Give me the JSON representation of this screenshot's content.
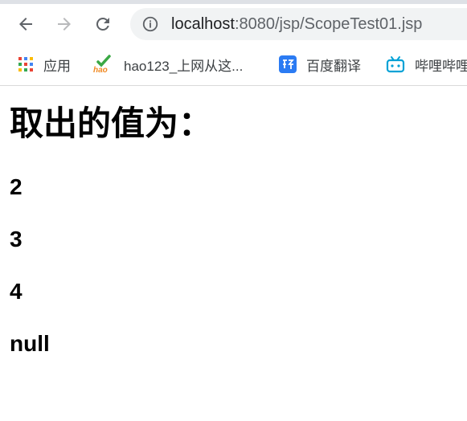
{
  "browser": {
    "url_host": "localhost",
    "url_rest": ":8080/jsp/ScopeTest01.jsp",
    "bookmarks": [
      {
        "label": "应用",
        "icon": "apps-grid-icon"
      },
      {
        "label": "hao123_上网从这...",
        "icon": "hao123-icon"
      },
      {
        "label": "百度翻译",
        "icon": "baidu-fanyi-icon"
      },
      {
        "label": "哔哩哔哩",
        "icon": "bilibili-icon"
      }
    ]
  },
  "page": {
    "heading": "取出的值为：",
    "values": [
      "2",
      "3",
      "4",
      "null"
    ]
  },
  "colors": {
    "omnibox_bg": "#f1f3f4",
    "fanyi_blue": "#2b7bf3",
    "bili_blue": "#00a1d6"
  }
}
